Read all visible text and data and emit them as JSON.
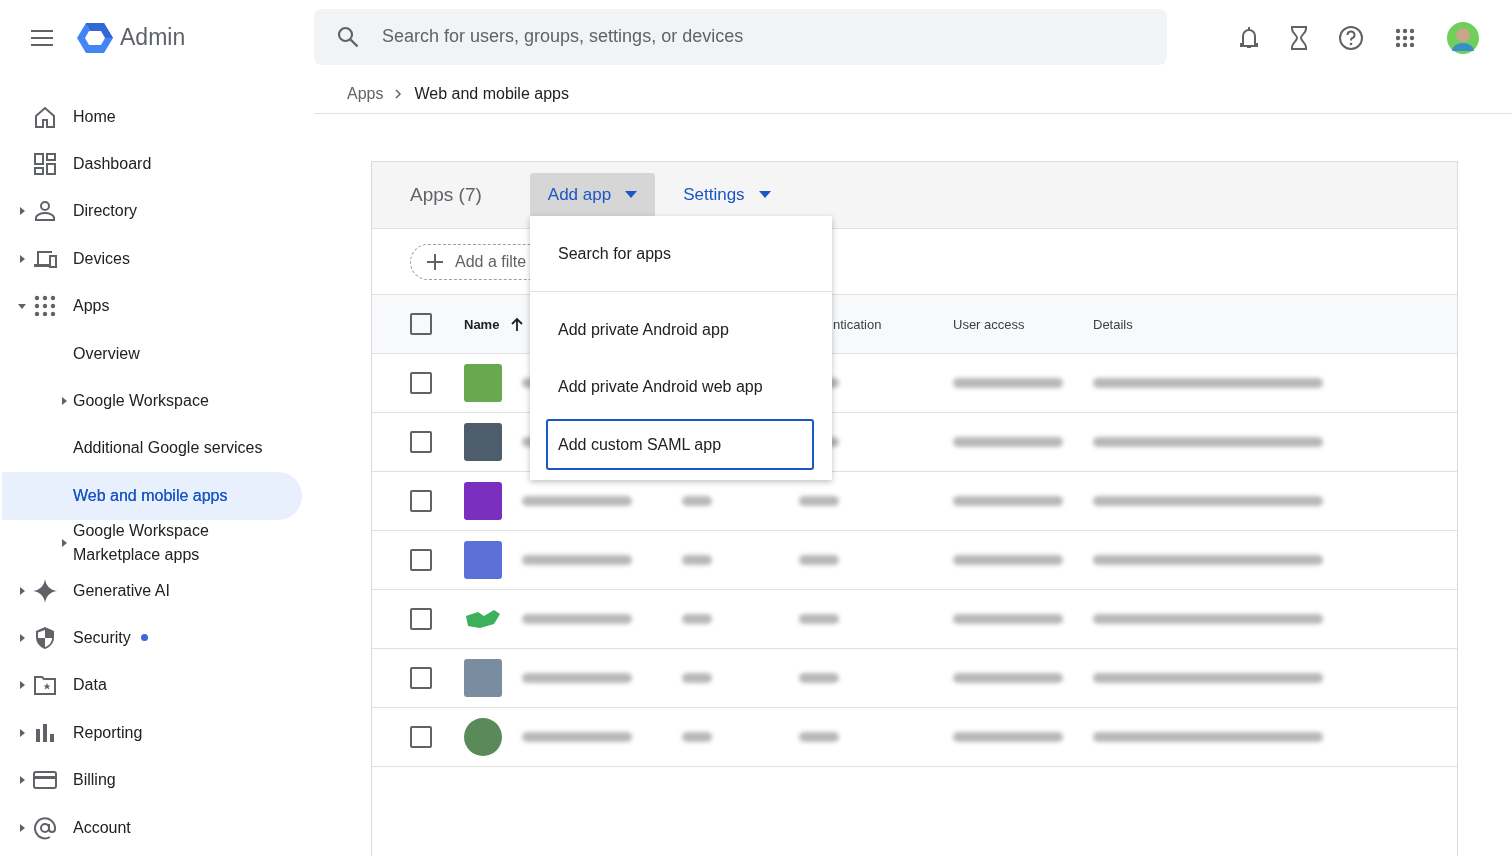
{
  "header": {
    "product": "Admin",
    "search": {
      "placeholder": "Search for users, groups, settings, or devices"
    }
  },
  "sidebar": {
    "items": [
      {
        "label": "Home",
        "notification": false
      },
      {
        "label": "Dashboard",
        "notification": false
      },
      {
        "label": "Directory",
        "expanded": false,
        "notification": false
      },
      {
        "label": "Devices",
        "expanded": false,
        "notification": false
      },
      {
        "label": "Apps",
        "expanded": true,
        "notification": false,
        "children": [
          {
            "label": "Overview",
            "selected": false
          },
          {
            "label": "Google Workspace",
            "expanded": false,
            "selected": false
          },
          {
            "label": "Additional Google services",
            "selected": false
          },
          {
            "label": "Web and mobile apps",
            "selected": true
          },
          {
            "label": "Google Workspace Marketplace apps",
            "expanded": false,
            "selected": false
          }
        ]
      },
      {
        "label": "Generative AI",
        "expanded": false,
        "notification": false
      },
      {
        "label": "Security",
        "expanded": false,
        "notification": true
      },
      {
        "label": "Data",
        "expanded": false,
        "notification": false
      },
      {
        "label": "Reporting",
        "expanded": false,
        "notification": false
      },
      {
        "label": "Billing",
        "expanded": false,
        "notification": false
      },
      {
        "label": "Account",
        "expanded": false,
        "notification": false
      }
    ]
  },
  "breadcrumb": [
    "Apps",
    "Web and mobile apps"
  ],
  "card": {
    "title": "Apps (7)",
    "buttons": [
      {
        "label": "Add app",
        "pressed": true
      },
      {
        "label": "Settings",
        "pressed": false
      }
    ],
    "filter": {
      "label": "Add a filte"
    },
    "table": {
      "select_all": {
        "checked": false
      },
      "columns": [
        {
          "label": "Name",
          "sorted": true
        },
        {
          "label": "ntication",
          "sorted": false
        },
        {
          "label": "User access",
          "sorted": false
        },
        {
          "label": "Details",
          "sorted": false
        }
      ],
      "rows": [
        {
          "checked": false,
          "kind": "square",
          "color": "#6aa84f"
        },
        {
          "checked": false,
          "kind": "square",
          "color": "#4e5d6c"
        },
        {
          "checked": false,
          "kind": "square",
          "color": "#7b2fbf"
        },
        {
          "checked": false,
          "kind": "square",
          "color": "#5b6fd6"
        },
        {
          "checked": false,
          "kind": "logo",
          "color": "#3cb05a"
        },
        {
          "checked": false,
          "kind": "square",
          "color": "#7a8da0"
        },
        {
          "checked": false,
          "kind": "round",
          "color": "#5a8a5a"
        }
      ]
    },
    "menu": {
      "sections": [
        [
          {
            "label": "Search for apps",
            "focused": false
          }
        ],
        [
          {
            "label": "Add private Android app",
            "focused": false
          },
          {
            "label": "Add private Android web app",
            "focused": false
          },
          {
            "label": "Add custom SAML app",
            "focused": true
          }
        ]
      ]
    }
  }
}
